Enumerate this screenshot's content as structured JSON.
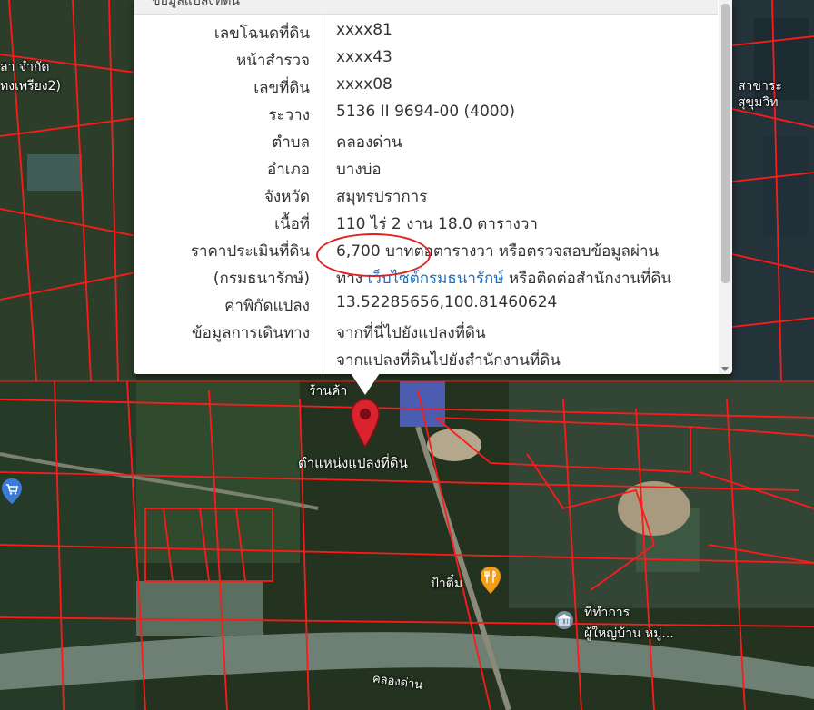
{
  "popup": {
    "header": "ข้อมูลแปลงที่ดิน",
    "rows": [
      {
        "label": "เลขโฉนดที่ดิน",
        "value": "xxxx81"
      },
      {
        "label": "หน้าสำรวจ",
        "value": "xxxx43"
      },
      {
        "label": "เลขที่ดิน",
        "value": "xxxx08"
      },
      {
        "label": "ระวาง",
        "value": "5136 II 9694-00 (4000)"
      },
      {
        "label": "ตำบล",
        "value": "คลองด่าน"
      },
      {
        "label": "อำเภอ",
        "value": "บางบ่อ"
      },
      {
        "label": "จังหวัด",
        "value": "สมุทรปราการ"
      },
      {
        "label": "เนื้อที่",
        "value": "110 ไร่ 2 งาน 18.0 ตารางวา"
      },
      {
        "label": "ราคาประเมินที่ดิน",
        "value": "6,700 บาทต่อตารางวา หรือตรวจสอบข้อมูลผ่าน"
      },
      {
        "label": "(กรมธนารักษ์)",
        "value_prefix": "ทาง",
        "value_link": "เว็บไซต์กรมธนารักษ์",
        "value_suffix": "หรือติดต่อสำนักงานที่ดิน"
      },
      {
        "label": "ค่าพิกัดแปลง",
        "value": "13.52285656,100.81460624"
      },
      {
        "label": "ข้อมูลการเดินทาง",
        "value": "จากที่นี่ไปยังแปลงที่ดิน"
      },
      {
        "label": "",
        "value": "จากแปลงที่ดินไปยังสำนักงานที่ดิน"
      }
    ]
  },
  "map": {
    "marker_label": "ตำแหน่งแปลงที่ดิน",
    "labels": {
      "poi_top_left": "ลา จำกัด",
      "poi_top_left2": "ทงเพรียง2)",
      "poi_top_right": "สาขาระ",
      "poi_top_right2": "สุขุมวิท",
      "shop_near_marker": "ร้านค้า",
      "restaurant": "ป้าติ๋ม",
      "village_office": "ที่ทำการ",
      "village_office2": "ผู้ใหญ่บ้าน หมู่...",
      "canal": "คลองด่าน"
    },
    "colors": {
      "parcel_line": "#ff1a1a",
      "marker": "#d9232e",
      "popup_link": "#1f6fbf",
      "annotation_circle": "#d22222"
    }
  }
}
